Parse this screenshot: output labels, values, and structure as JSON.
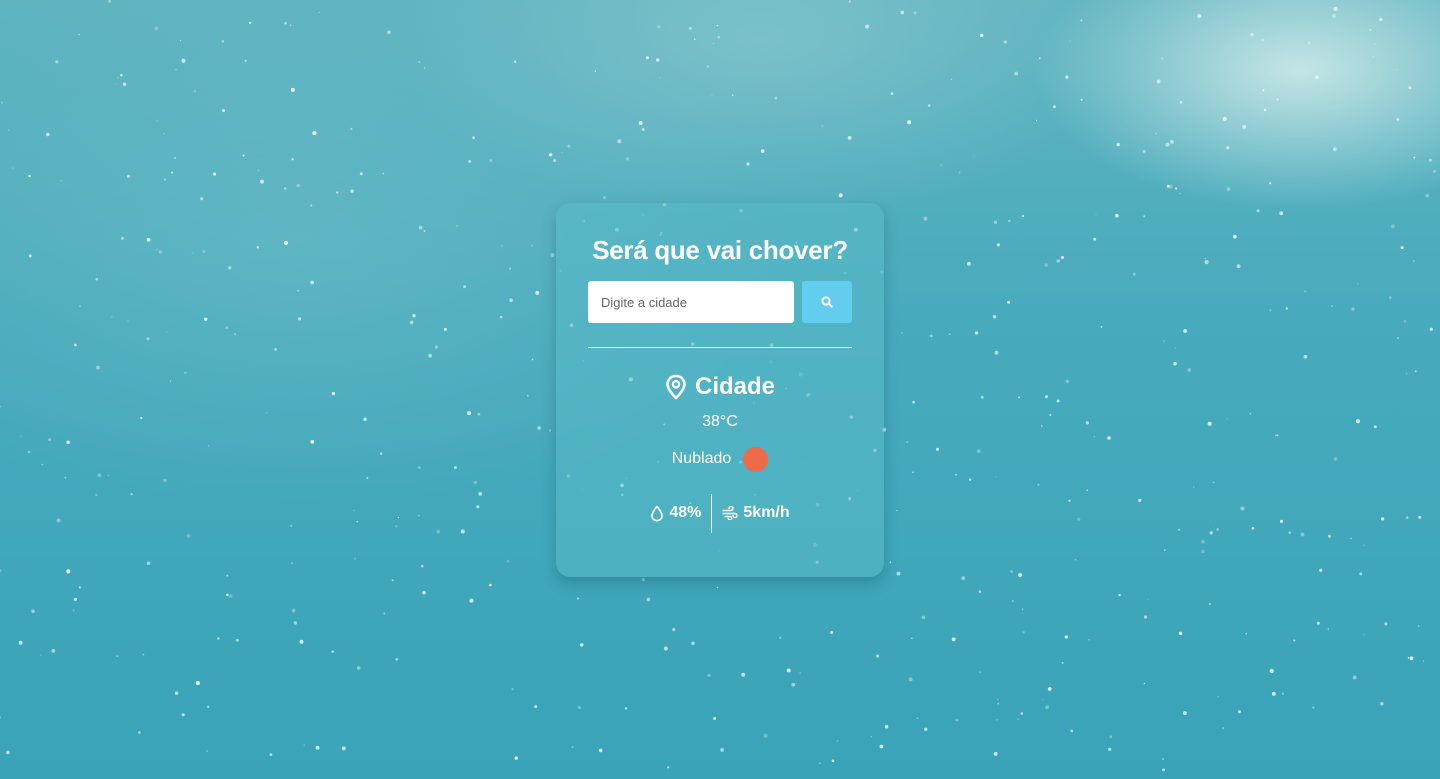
{
  "app": {
    "title": "Será que vai chover?"
  },
  "search": {
    "placeholder": "Digite a cidade",
    "value": "",
    "button_icon": "search-icon"
  },
  "weather": {
    "city": "Cidade",
    "city_icon": "map-pin-icon",
    "temperature": "38°C",
    "description": "Nublado",
    "condition_icon": "weather-condition-icon",
    "humidity": "48%",
    "humidity_icon": "droplet-icon",
    "wind": "5km/h",
    "wind_icon": "wind-icon"
  },
  "colors": {
    "background": "#45aabb",
    "card": "#5ab9c8",
    "button": "#63cdf0",
    "condition_icon": "#ef6a4a",
    "text": "#ffffff"
  }
}
